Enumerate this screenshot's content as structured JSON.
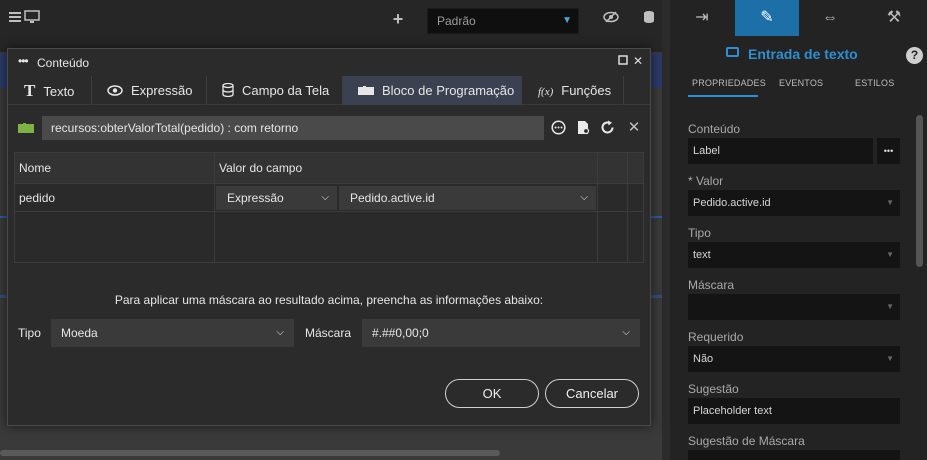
{
  "toolbar": {
    "variant": "Padrão",
    "icons": [
      "monitor-icon",
      "plus-icon",
      "eye-slash-icon",
      "database-icon"
    ]
  },
  "right_panel": {
    "tabs": [
      "enter-icon",
      "pencil-icon",
      "arrows-icon",
      "wrench-icon"
    ],
    "title": "Entrada de texto",
    "prop_tabs": [
      "PROPRIEDADES",
      "EVENTOS",
      "ESTILOS"
    ],
    "fields": [
      {
        "label": "Conteúdo",
        "value": "Label"
      },
      {
        "label": "* Valor",
        "value": "Pedido.active.id"
      },
      {
        "label": "Tipo",
        "value": "text"
      },
      {
        "label": "Máscara",
        "value": ""
      },
      {
        "label": "Requerido",
        "value": "Não"
      },
      {
        "label": "Sugestão",
        "value": "Placeholder text"
      },
      {
        "label": "Sugestão de Máscara",
        "value": ""
      }
    ],
    "more": "•••",
    "help": "?"
  },
  "modal": {
    "title": "Conteúdo",
    "tabs": [
      {
        "label": "Texto",
        "icon": "T"
      },
      {
        "label": "Expressão",
        "icon": "eye"
      },
      {
        "label": "Campo da Tela",
        "icon": "database"
      },
      {
        "label": "Bloco de Programação",
        "icon": "block"
      },
      {
        "label": "Funções",
        "icon": "fx"
      }
    ],
    "formula": "recursos:obterValorTotal(pedido) : com retorno",
    "grid": {
      "headers": [
        "Nome",
        "Valor do campo"
      ],
      "row": {
        "name": "pedido",
        "type": "Expressão",
        "value": "Pedido.active.id"
      }
    },
    "mask_hint": "Para aplicar uma máscara ao resultado acima, preencha as informações abaixo:",
    "type_label": "Tipo",
    "type_value": "Moeda",
    "mask_label": "Máscara",
    "mask_value": "#.##0,00;0",
    "ok": "OK",
    "cancel": "Cancelar"
  }
}
